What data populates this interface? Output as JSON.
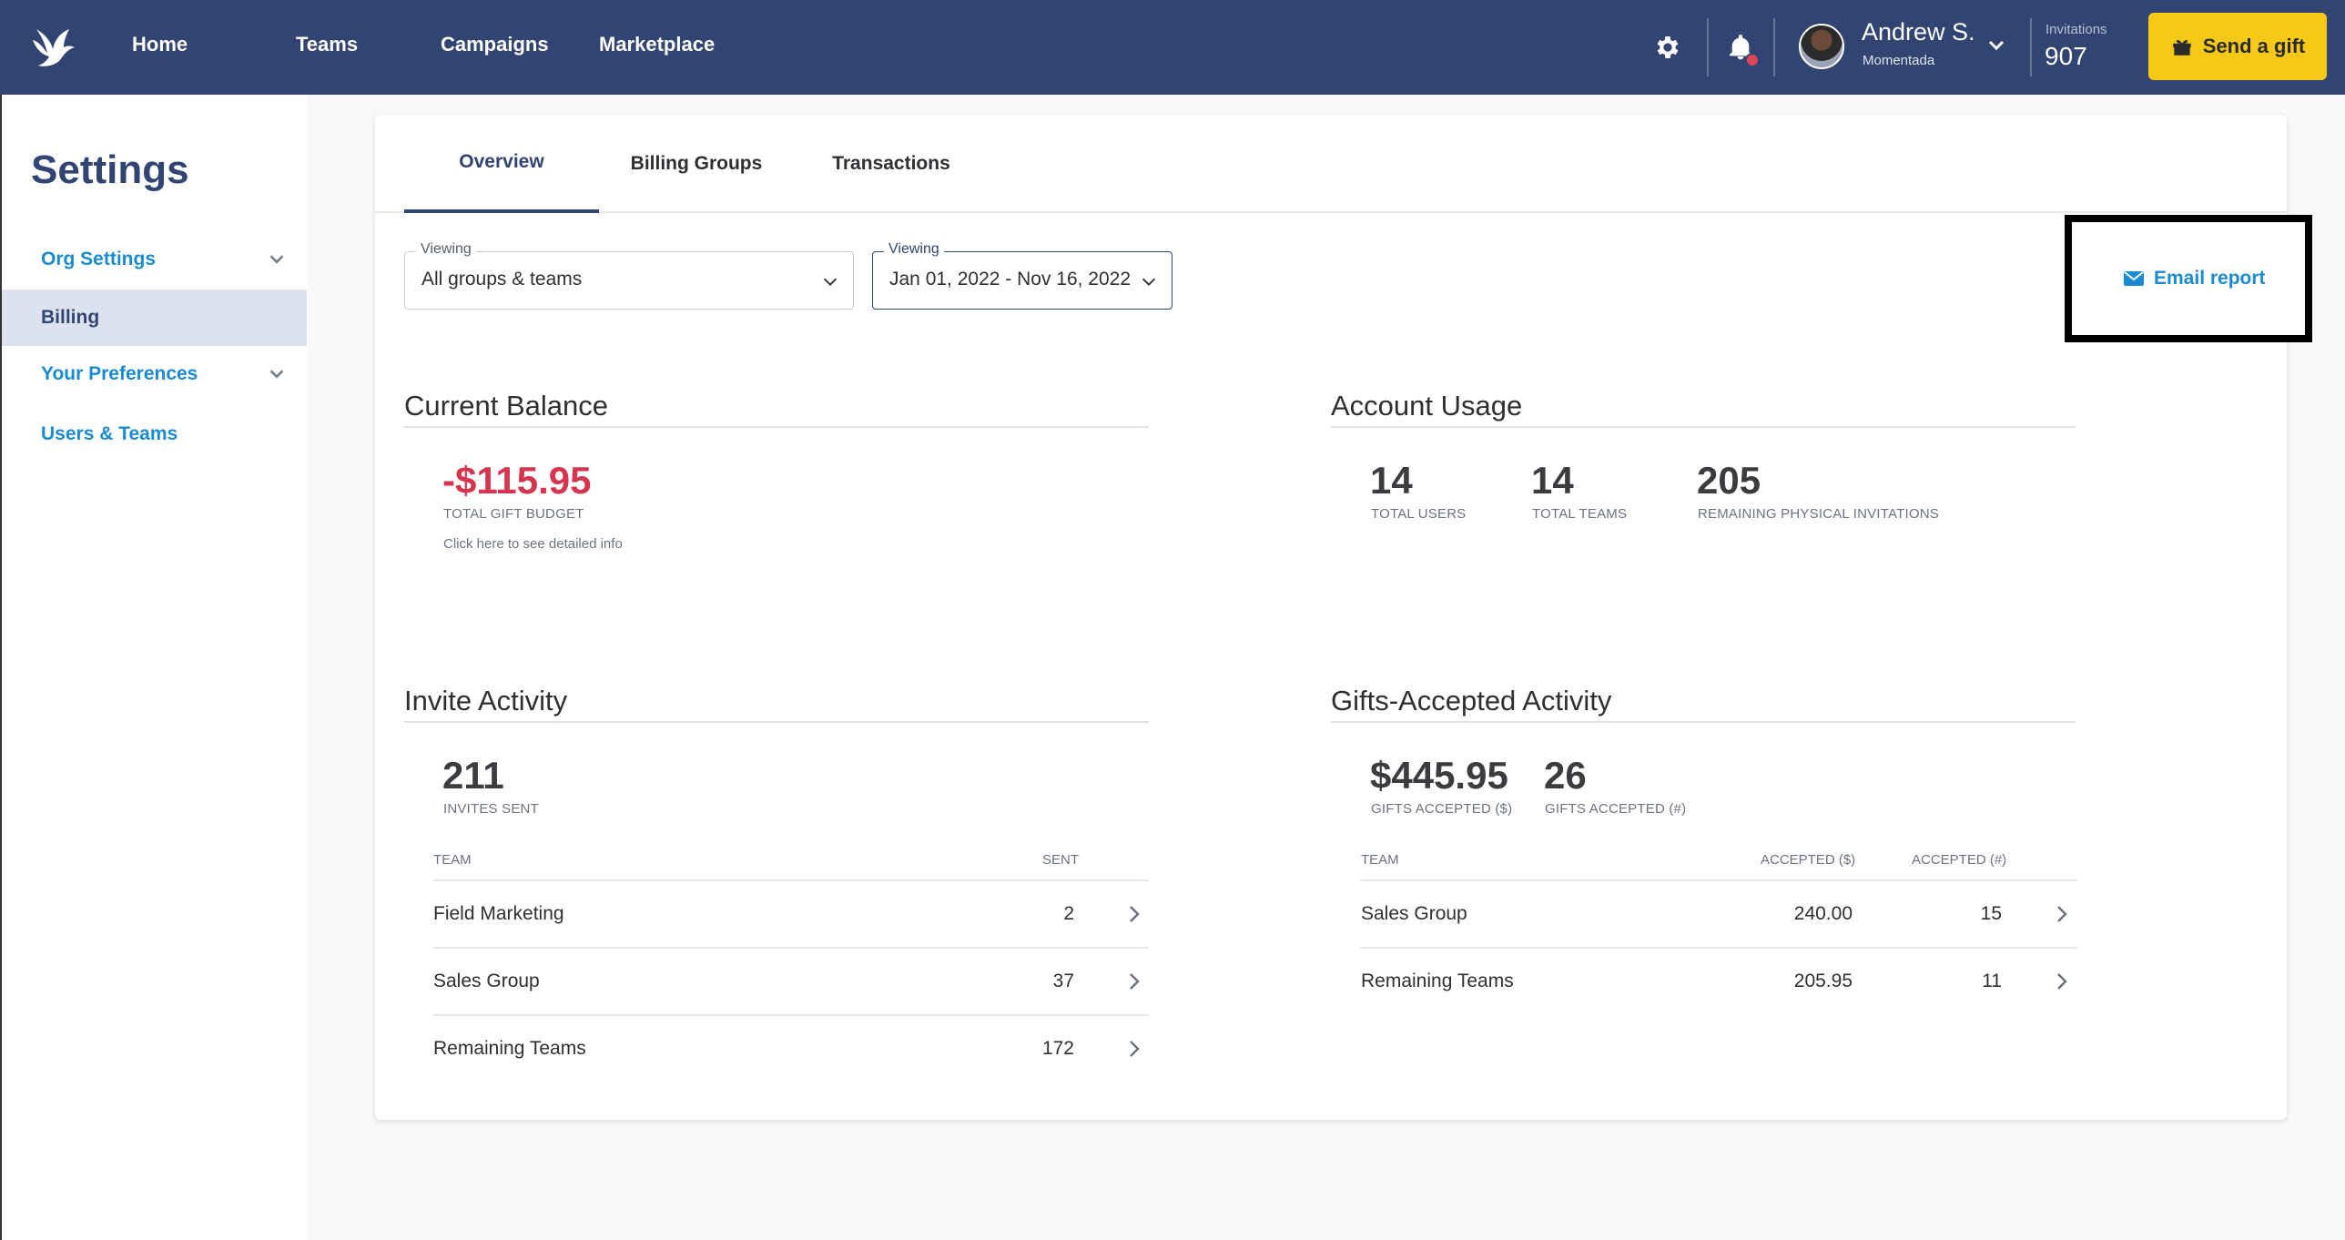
{
  "nav": {
    "home": "Home",
    "teams": "Teams",
    "campaigns": "Campaigns",
    "marketplace": "Marketplace"
  },
  "user": {
    "name": "Andrew S.",
    "org": "Momentada"
  },
  "invitations": {
    "label": "Invitations",
    "count": "907"
  },
  "send_gift_label": "Send a gift",
  "sidebar": {
    "title": "Settings",
    "items": [
      {
        "label": "Org Settings"
      },
      {
        "label": "Billing"
      },
      {
        "label": "Your Preferences"
      },
      {
        "label": "Users & Teams"
      }
    ]
  },
  "tabs": [
    {
      "label": "Overview"
    },
    {
      "label": "Billing Groups"
    },
    {
      "label": "Transactions"
    }
  ],
  "filters": {
    "groups": {
      "label": "Viewing",
      "value": "All groups & teams"
    },
    "dates": {
      "label": "Viewing",
      "value": "Jan 01, 2022 - Nov 16, 2022"
    }
  },
  "email_report_label": "Email report",
  "balance": {
    "title": "Current Balance",
    "value": "-$115.95",
    "caption": "TOTAL GIFT BUDGET",
    "link": "Click here to see detailed info"
  },
  "usage": {
    "title": "Account Usage",
    "stats": [
      {
        "value": "14",
        "caption": "TOTAL USERS"
      },
      {
        "value": "14",
        "caption": "TOTAL TEAMS"
      },
      {
        "value": "205",
        "caption": "REMAINING PHYSICAL INVITATIONS"
      }
    ]
  },
  "invite": {
    "title": "Invite Activity",
    "value": "211",
    "caption": "INVITES SENT",
    "columns": [
      "TEAM",
      "SENT"
    ],
    "rows": [
      {
        "team": "Field Marketing",
        "sent": "2"
      },
      {
        "team": "Sales Group",
        "sent": "37"
      },
      {
        "team": "Remaining Teams",
        "sent": "172"
      }
    ]
  },
  "gifts": {
    "title": "Gifts-Accepted Activity",
    "stats": [
      {
        "value": "$445.95",
        "caption": "GIFTS ACCEPTED ($)"
      },
      {
        "value": "26",
        "caption": "GIFTS ACCEPTED (#)"
      }
    ],
    "columns": [
      "TEAM",
      "ACCEPTED ($)",
      "ACCEPTED (#)"
    ],
    "rows": [
      {
        "team": "Sales Group",
        "amount": "240.00",
        "count": "15"
      },
      {
        "team": "Remaining Teams",
        "amount": "205.95",
        "count": "11"
      }
    ]
  },
  "colors": {
    "nav_bg": "#324472",
    "accent": "#1a8bd1",
    "cta": "#f6c919",
    "negative": "#d6354f"
  }
}
